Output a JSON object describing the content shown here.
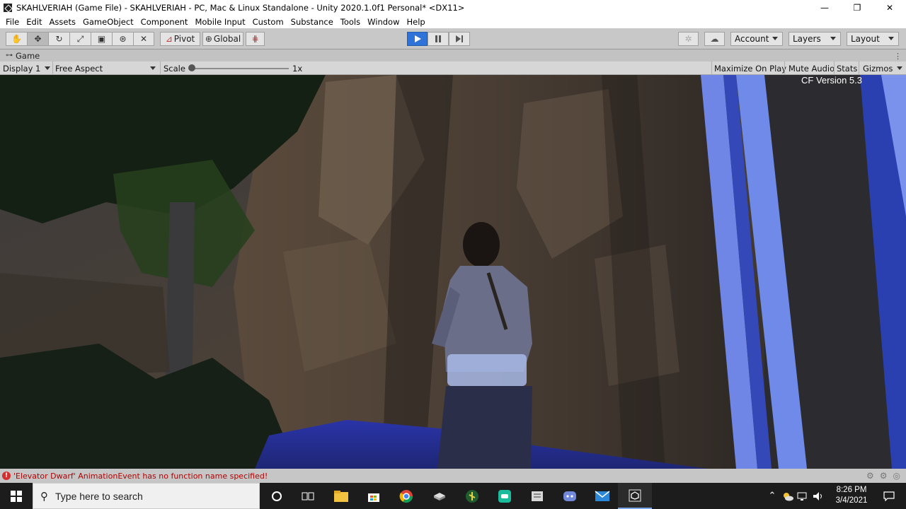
{
  "window": {
    "title": "SKAHLVERIAH (Game File) - SKAHLVERIAH - PC, Mac & Linux Standalone - Unity 2020.1.0f1 Personal* <DX11>",
    "minimize_glyph": "—",
    "maximize_glyph": "❐",
    "close_glyph": "✕"
  },
  "menu": {
    "items": [
      "File",
      "Edit",
      "Assets",
      "GameObject",
      "Component",
      "Mobile Input",
      "Custom",
      "Substance",
      "Tools",
      "Window",
      "Help"
    ]
  },
  "toolbar": {
    "tool_icons": [
      "hand-tool-icon",
      "move-tool-icon",
      "rotate-tool-icon",
      "scale-tool-icon",
      "rect-tool-icon",
      "transform-tool-icon",
      "custom-tool-icon"
    ],
    "pivot_label": "Pivot",
    "global_label": "Global",
    "account_label": "Account",
    "layers_label": "Layers",
    "layout_label": "Layout",
    "play_color": "#2f73d8"
  },
  "game_tab": {
    "label": "Game"
  },
  "game_bar": {
    "display": "Display 1",
    "aspect": "Free Aspect",
    "scale_label": "Scale",
    "scale_value": "1x",
    "maximize_on_play": "Maximize On Play",
    "mute_audio": "Mute Audio",
    "stats": "Stats",
    "gizmos": "Gizmos"
  },
  "game_view": {
    "version_text": "CF Version 5.3",
    "accent_blue": "#4f6fd8"
  },
  "status": {
    "message": "'Elevator Dwarf' AnimationEvent has no function name specified!",
    "error_color": "#d32f2f"
  },
  "taskbar": {
    "search_placeholder": "Type here to search",
    "apps": [
      "cortana-icon",
      "task-view-icon",
      "file-explorer-icon",
      "store-icon",
      "chrome-icon",
      "app-icon",
      "game-icon",
      "app-icon-green",
      "notes-icon",
      "discord-icon",
      "mail-icon",
      "unity-icon"
    ],
    "time": "8:26 PM",
    "date": "3/4/2021"
  }
}
